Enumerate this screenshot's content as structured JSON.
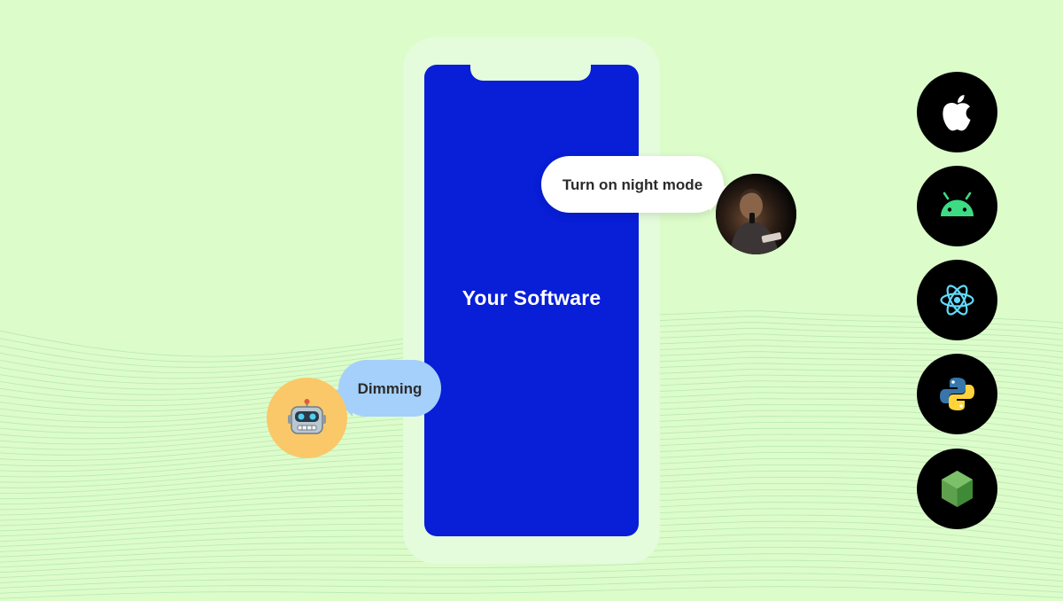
{
  "phone": {
    "title": "Your Software",
    "screen_color": "#081ed7"
  },
  "chat": {
    "user_message": "Turn on night mode",
    "bot_reply": "Dimming"
  },
  "platform_icons": [
    "apple-icon",
    "android-icon",
    "react-icon",
    "python-icon",
    "nodejs-icon"
  ],
  "colors": {
    "background": "#dcfcca",
    "bot_bubble": "#a4d0fb",
    "bot_avatar": "#fac868",
    "android": "#3ddc84",
    "react": "#61dafb",
    "python_blue": "#3776ab",
    "python_yellow": "#ffd43b",
    "node": "#5fa04e"
  }
}
